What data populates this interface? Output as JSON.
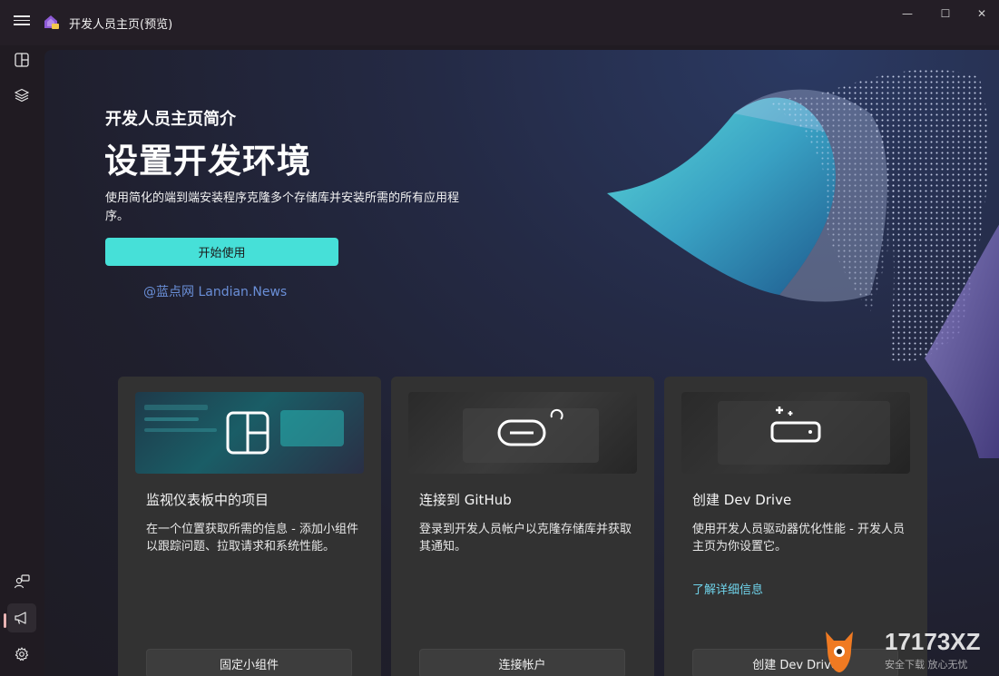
{
  "window": {
    "title": "开发人员主页(预览)",
    "minimize": "—",
    "maximize": "☐",
    "close": "✕"
  },
  "hero": {
    "subtitle": "开发人员主页简介",
    "title": "设置开发环境",
    "description": "使用简化的端到端安装程序克隆多个存储库并安装所需的所有应用程序。",
    "button_label": "开始使用",
    "watermark": "@蓝点网 Landian.News"
  },
  "cards": [
    {
      "title": "监视仪表板中的项目",
      "description": "在一个位置获取所需的信息 - 添加小组件以跟踪问题、拉取请求和系统性能。",
      "button_label": "固定小组件"
    },
    {
      "title": "连接到 GitHub",
      "description": "登录到开发人员帐户以克隆存储库并获取其通知。",
      "button_label": "连接帐户"
    },
    {
      "title": "创建 Dev Drive",
      "description": "使用开发人员驱动器优化性能 - 开发人员主页为你设置它。",
      "link_label": "了解详细信息",
      "button_label": "创建 Dev Drive"
    }
  ],
  "corner_logo": {
    "brand": "17173XZ",
    "tagline": "安全下载 放心无忧"
  },
  "colors": {
    "accent": "#46e0d8",
    "link": "#6fd3ea",
    "card_bg": "#323232",
    "window_bg": "#201b22"
  },
  "icons": {
    "menu": "hamburger-icon",
    "nav_dashboard": "dashboard-icon",
    "nav_layers": "layers-icon",
    "nav_feedback": "person-feedback-icon",
    "nav_whats_new": "megaphone-icon",
    "nav_settings": "gear-icon"
  }
}
